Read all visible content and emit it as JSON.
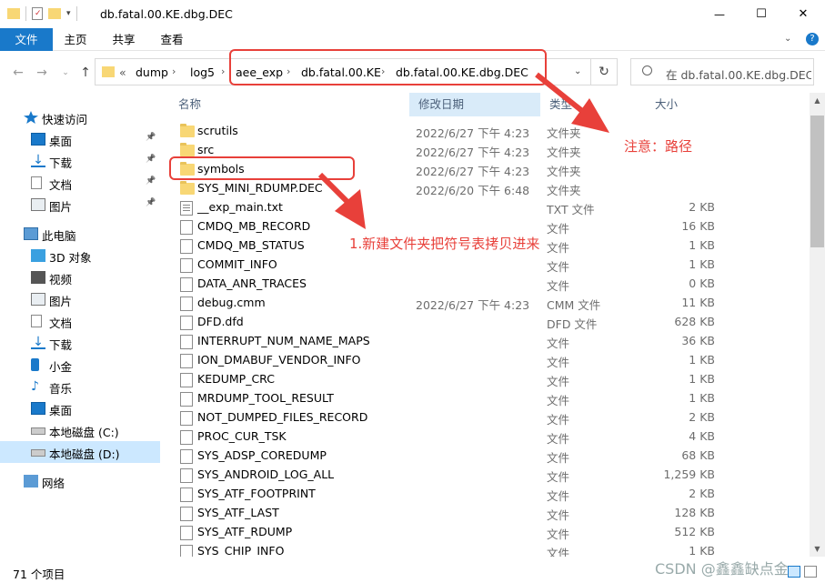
{
  "window": {
    "title": "db.fatal.00.KE.dbg.DEC",
    "controls": {
      "minimize": "—",
      "maximize": "☐",
      "close": "✕"
    }
  },
  "ribbon": {
    "tabs": [
      "文件",
      "主页",
      "共享",
      "查看"
    ],
    "help_glyph": "?"
  },
  "address": {
    "overflow": "«",
    "crumbs": [
      "dump",
      "log5",
      "aee_exp",
      "db.fatal.00.KE",
      "db.fatal.00.KE.dbg.DEC"
    ]
  },
  "search": {
    "placeholder": "在 db.fatal.00.KE.dbg.DEC..."
  },
  "sidebar": {
    "items": [
      {
        "label": "快速访问",
        "icon": "star-icon",
        "pinned": false
      },
      {
        "label": "桌面",
        "icon": "desktop-icon",
        "pinned": true
      },
      {
        "label": "下载",
        "icon": "download-icon",
        "pinned": true
      },
      {
        "label": "文档",
        "icon": "document-icon",
        "pinned": true
      },
      {
        "label": "图片",
        "icon": "picture-icon",
        "pinned": true
      },
      {
        "label": "此电脑",
        "icon": "computer-icon",
        "pinned": false
      },
      {
        "label": "3D 对象",
        "icon": "cube-icon",
        "pinned": false
      },
      {
        "label": "视频",
        "icon": "video-icon",
        "pinned": false
      },
      {
        "label": "图片",
        "icon": "picture-icon",
        "pinned": false
      },
      {
        "label": "文档",
        "icon": "document-icon",
        "pinned": false
      },
      {
        "label": "下载",
        "icon": "download-icon",
        "pinned": false
      },
      {
        "label": "小金",
        "icon": "phone-icon",
        "pinned": false
      },
      {
        "label": "音乐",
        "icon": "music-icon",
        "pinned": false
      },
      {
        "label": "桌面",
        "icon": "desktop-icon",
        "pinned": false
      },
      {
        "label": "本地磁盘 (C:)",
        "icon": "drive-icon",
        "pinned": false
      },
      {
        "label": "本地磁盘 (D:)",
        "icon": "drive-icon",
        "pinned": false,
        "selected": true
      },
      {
        "label": "网络",
        "icon": "network-icon",
        "pinned": false
      }
    ]
  },
  "columns": {
    "name": "名称",
    "date": "修改日期",
    "type": "类型",
    "size": "大小"
  },
  "files": [
    {
      "name": "scrutils",
      "date": "2022/6/27 下午 4:23",
      "type": "文件夹",
      "size": "",
      "icon": "folder"
    },
    {
      "name": "src",
      "date": "2022/6/27 下午 4:23",
      "type": "文件夹",
      "size": "",
      "icon": "folder"
    },
    {
      "name": "symbols",
      "date": "2022/6/27 下午 4:23",
      "type": "文件夹",
      "size": "",
      "icon": "folder"
    },
    {
      "name": "SYS_MINI_RDUMP.DEC",
      "date": "2022/6/20 下午 6:48",
      "type": "文件夹",
      "size": "",
      "icon": "folder"
    },
    {
      "name": "__exp_main.txt",
      "date": "",
      "type": "TXT 文件",
      "size": "2 KB",
      "icon": "txt"
    },
    {
      "name": "CMDQ_MB_RECORD",
      "date": "",
      "type": "文件",
      "size": "16 KB",
      "icon": "doc"
    },
    {
      "name": "CMDQ_MB_STATUS",
      "date": "",
      "type": "文件",
      "size": "1 KB",
      "icon": "doc"
    },
    {
      "name": "COMMIT_INFO",
      "date": "",
      "type": "文件",
      "size": "1 KB",
      "icon": "doc"
    },
    {
      "name": "DATA_ANR_TRACES",
      "date": "",
      "type": "文件",
      "size": "0 KB",
      "icon": "doc"
    },
    {
      "name": "debug.cmm",
      "date": "2022/6/27 下午 4:23",
      "type": "CMM 文件",
      "size": "11 KB",
      "icon": "doc"
    },
    {
      "name": "DFD.dfd",
      "date": "",
      "type": "DFD 文件",
      "size": "628 KB",
      "icon": "doc"
    },
    {
      "name": "INTERRUPT_NUM_NAME_MAPS",
      "date": "",
      "type": "文件",
      "size": "36 KB",
      "icon": "doc"
    },
    {
      "name": "ION_DMABUF_VENDOR_INFO",
      "date": "",
      "type": "文件",
      "size": "1 KB",
      "icon": "doc"
    },
    {
      "name": "KEDUMP_CRC",
      "date": "",
      "type": "文件",
      "size": "1 KB",
      "icon": "doc"
    },
    {
      "name": "MRDUMP_TOOL_RESULT",
      "date": "",
      "type": "文件",
      "size": "1 KB",
      "icon": "doc"
    },
    {
      "name": "NOT_DUMPED_FILES_RECORD",
      "date": "",
      "type": "文件",
      "size": "2 KB",
      "icon": "doc"
    },
    {
      "name": "PROC_CUR_TSK",
      "date": "",
      "type": "文件",
      "size": "4 KB",
      "icon": "doc"
    },
    {
      "name": "SYS_ADSP_COREDUMP",
      "date": "",
      "type": "文件",
      "size": "68 KB",
      "icon": "doc"
    },
    {
      "name": "SYS_ANDROID_LOG_ALL",
      "date": "",
      "type": "文件",
      "size": "1,259 KB",
      "icon": "doc"
    },
    {
      "name": "SYS_ATF_FOOTPRINT",
      "date": "",
      "type": "文件",
      "size": "2 KB",
      "icon": "doc"
    },
    {
      "name": "SYS_ATF_LAST",
      "date": "",
      "type": "文件",
      "size": "128 KB",
      "icon": "doc"
    },
    {
      "name": "SYS_ATF_RDUMP",
      "date": "",
      "type": "文件",
      "size": "512 KB",
      "icon": "doc"
    },
    {
      "name": "SYS_CHIP_INFO",
      "date": "",
      "type": "文件",
      "size": "1 KB",
      "icon": "doc"
    }
  ],
  "status": {
    "count": "71 个项目"
  },
  "annotations": {
    "path_note": "注意：路径",
    "symbols_note": "1.新建文件夹把符号表拷贝进来",
    "color": "#e8403a"
  },
  "watermark": "CSDN @鑫鑫缺点金"
}
